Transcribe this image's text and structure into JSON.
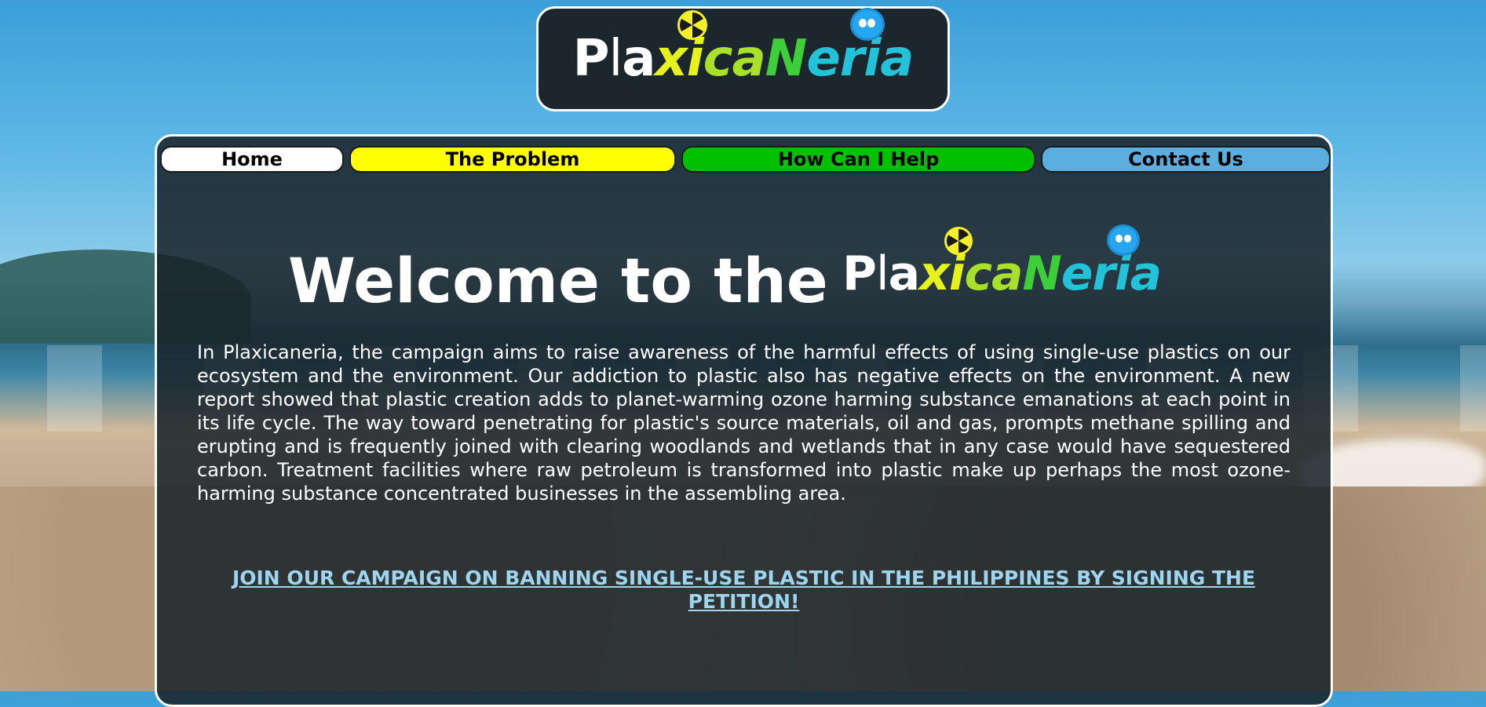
{
  "brand": {
    "logo_parts": [
      "P",
      "l",
      "a",
      "xi",
      "ca",
      "N",
      "eria"
    ],
    "colors": {
      "white": "#ffffff",
      "yellow": "#e6f21c",
      "green": "#3dcf3a",
      "cyan": "#22c3d9"
    }
  },
  "nav": {
    "items": [
      {
        "label": "Home",
        "color": "#ffffff"
      },
      {
        "label": "The Problem",
        "color": "#ffff00"
      },
      {
        "label": "How Can I Help",
        "color": "#00c000"
      },
      {
        "label": "Contact Us",
        "color": "#5aaee0"
      }
    ]
  },
  "main": {
    "welcome": "Welcome to the",
    "paragraph": "In Plaxicaneria, the campaign aims to raise awareness of the harmful effects of using single-use plastics on our ecosystem and the environment. Our addiction to plastic also has negative effects on the environment. A new report showed that plastic creation adds to planet-warming ozone harming substance emanations at each point in its life cycle. The way toward penetrating for plastic's source materials, oil and gas, prompts methane spilling and erupting and is frequently joined with clearing woodlands and wetlands that in any case would have sequestered carbon. Treatment facilities where raw petroleum is transformed into plastic make up perhaps the most ozone-harming substance concentrated businesses in the assembling area.",
    "petition_link": "JOIN OUR CAMPAIGN ON BANNING SINGLE-USE PLASTIC IN THE PHILIPPINES BY SIGNING THE PETITION!"
  }
}
